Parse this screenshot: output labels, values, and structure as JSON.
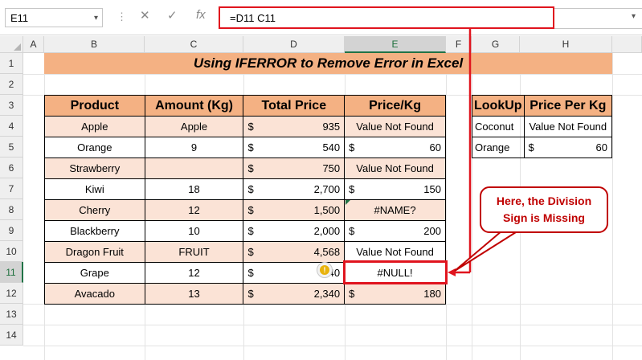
{
  "formula_bar": {
    "name_box": "E11",
    "fx_label": "fx",
    "cancel_glyph": "✕",
    "confirm_glyph": "✓",
    "formula": "=D11 C11"
  },
  "columns": [
    "A",
    "B",
    "C",
    "D",
    "E",
    "F",
    "G",
    "H"
  ],
  "selected_column": "E",
  "rows": [
    "1",
    "2",
    "3",
    "4",
    "5",
    "6",
    "7",
    "8",
    "9",
    "10",
    "11",
    "12",
    "13",
    "14"
  ],
  "selected_row": "11",
  "title": "Using IFERROR to Remove Error in Excel",
  "main_table": {
    "headers": [
      "Product",
      "Amount (Kg)",
      "Total Price",
      "Price/Kg"
    ],
    "rows": [
      {
        "product": "Apple",
        "amount": "Apple",
        "price_symbol": "$",
        "price": "935",
        "perkg_symbol": "",
        "perkg": "Value Not Found"
      },
      {
        "product": "Orange",
        "amount": "9",
        "price_symbol": "$",
        "price": "540",
        "perkg_symbol": "$",
        "perkg": "60"
      },
      {
        "product": "Strawberry",
        "amount": "",
        "price_symbol": "$",
        "price": "750",
        "perkg_symbol": "",
        "perkg": "Value Not Found"
      },
      {
        "product": "Kiwi",
        "amount": "18",
        "price_symbol": "$",
        "price": "2,700",
        "perkg_symbol": "$",
        "perkg": "150"
      },
      {
        "product": "Cherry",
        "amount": "12",
        "price_symbol": "$",
        "price": "1,500",
        "perkg_symbol": "",
        "perkg": "#NAME?"
      },
      {
        "product": "Blackberry",
        "amount": "10",
        "price_symbol": "$",
        "price": "2,000",
        "perkg_symbol": "$",
        "perkg": "200"
      },
      {
        "product": "Dragon Fruit",
        "amount": "FRUIT",
        "price_symbol": "$",
        "price": "4,568",
        "perkg_symbol": "",
        "perkg": "Value Not Found"
      },
      {
        "product": "Grape",
        "amount": "12",
        "price_symbol": "$",
        "price": "540",
        "perkg_symbol": "",
        "perkg": "#NULL!"
      },
      {
        "product": "Avacado",
        "amount": "13",
        "price_symbol": "$",
        "price": "2,340",
        "perkg_symbol": "$",
        "perkg": "180"
      }
    ]
  },
  "lookup_table": {
    "headers": [
      "LookUp",
      "Price Per Kg"
    ],
    "rows": [
      {
        "lookup": "Coconut",
        "symbol": "",
        "value": "Value Not Found"
      },
      {
        "lookup": "Orange",
        "symbol": "$",
        "value": "60"
      }
    ]
  },
  "callout": {
    "line1": "Here, the Division",
    "line2": "Sign is Missing"
  },
  "colors": {
    "header_fill": "#f4b183",
    "alt_row_fill": "#fbe3d6",
    "highlight_red": "#e0141e"
  },
  "icons": {
    "warning": "warning-icon"
  }
}
